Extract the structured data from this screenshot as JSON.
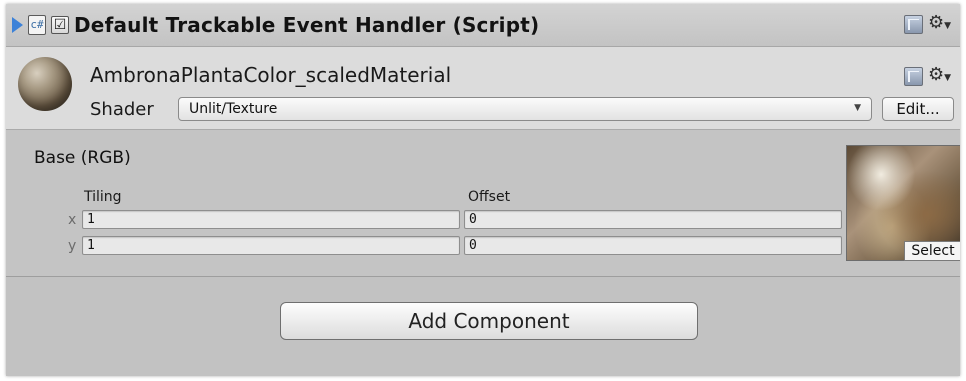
{
  "component": {
    "title": "Default Trackable Event Handler (Script)",
    "checkbox_glyph": "☑",
    "script_icon_glyph": "c#",
    "enabled": true
  },
  "material": {
    "name": "AmbronaPlantaColor_scaledMaterial",
    "shader_label": "Shader",
    "shader_value": "Unlit/Texture",
    "edit_label": "Edit..."
  },
  "texture_property": {
    "label": "Base (RGB)",
    "tiling_label": "Tiling",
    "offset_label": "Offset",
    "x_label": "x",
    "y_label": "y",
    "tiling_x": "1",
    "tiling_y": "1",
    "offset_x": "0",
    "offset_y": "0",
    "select_label": "Select"
  },
  "footer": {
    "add_component_label": "Add Component"
  },
  "icons": {
    "foldout": "foldout-arrow-icon",
    "help": "book-icon",
    "settings": "gear-icon"
  },
  "colors": {
    "foldout_arrow": "#3d82d8",
    "panel_bg": "#c2c2c2"
  }
}
